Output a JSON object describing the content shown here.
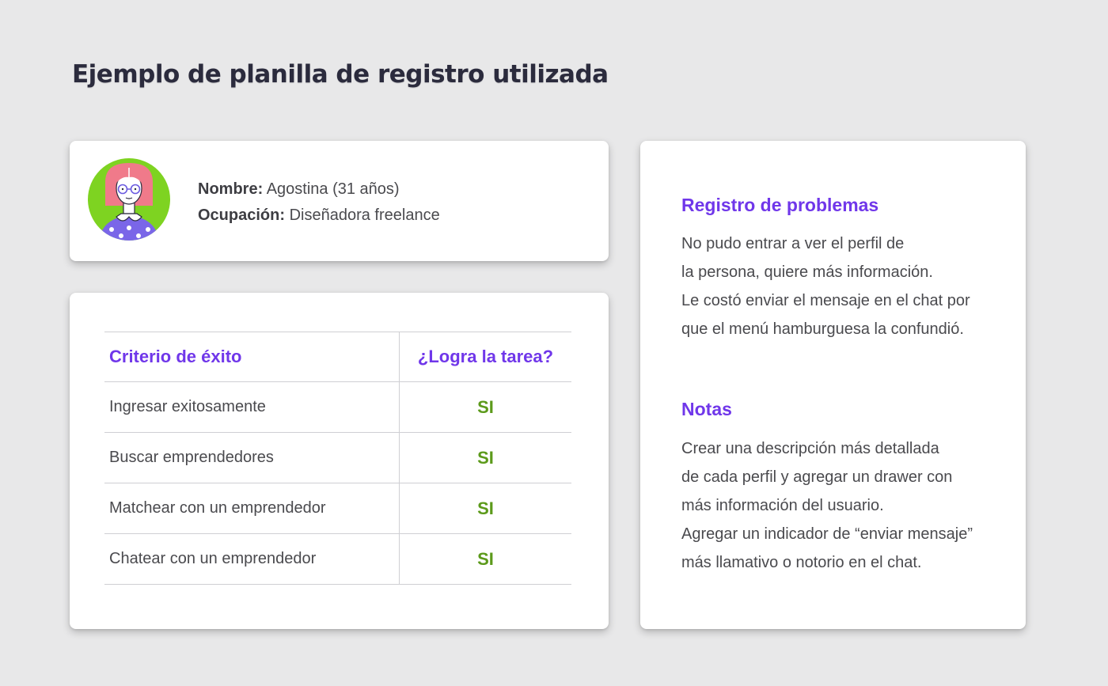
{
  "title": "Ejemplo de planilla de registro utilizada",
  "profile": {
    "name_label": "Nombre:",
    "name_value": "Agostina (31 años)",
    "occupation_label": "Ocupación:",
    "occupation_value": "Diseñadora freelance"
  },
  "table": {
    "headers": [
      "Criterio de éxito",
      "¿Logra la tarea?"
    ],
    "rows": [
      {
        "task": "Ingresar exitosamente",
        "result": "SI"
      },
      {
        "task": "Buscar emprendedores",
        "result": "SI"
      },
      {
        "task": "Matchear con un emprendedor",
        "result": "SI"
      },
      {
        "task": "Chatear con un emprendedor",
        "result": "SI"
      }
    ]
  },
  "problems": {
    "title": "Registro de problemas",
    "lines": [
      "No pudo entrar a ver el perfil de",
      "la persona, quiere más información.",
      "Le costó enviar el mensaje en el chat por",
      "que el menú hamburguesa la confundió."
    ]
  },
  "notes": {
    "title": "Notas",
    "lines": [
      "Crear una descripción más detallada",
      "de cada perfil y agregar un drawer con",
      "más información del usuario.",
      "Agregar un indicador de  “enviar mensaje”",
      "más llamativo o notorio en el chat."
    ]
  },
  "colors": {
    "background": "#e8e8e9",
    "accent_purple": "#7037ea",
    "success_green": "#5c9a1b",
    "avatar_background": "#7ed321"
  },
  "icons": {
    "avatar": "user-avatar-illustration"
  }
}
